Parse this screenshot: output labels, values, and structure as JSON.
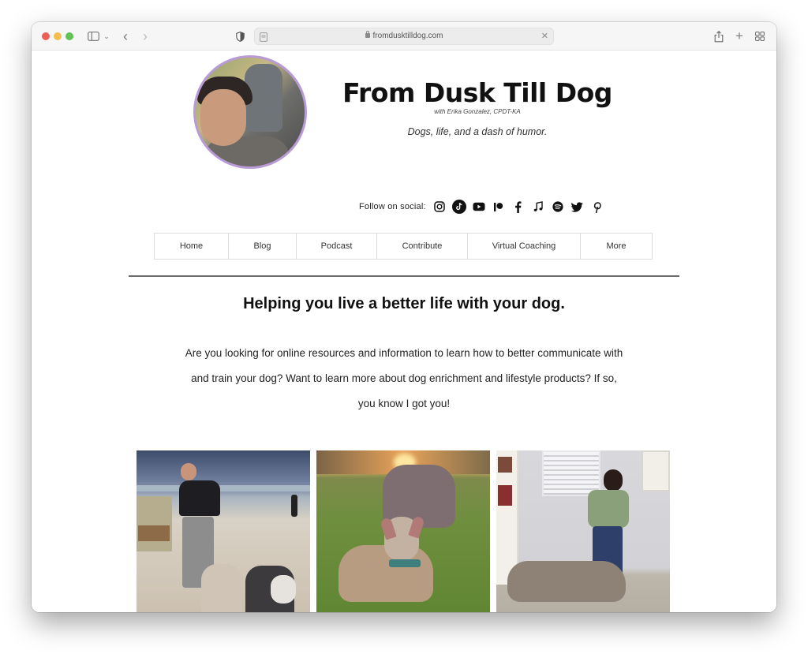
{
  "browser": {
    "url": "fromdusktilldog.com",
    "icons": {
      "sidebar": "sidebar-icon",
      "back": "chevron-left-icon",
      "forward": "chevron-right-icon",
      "privacy": "shield-icon",
      "reader": "reader-icon",
      "lock": "lock-icon",
      "clear": "close-icon",
      "share": "share-icon",
      "new_tab": "plus-icon",
      "tab_overview": "grid-icon"
    },
    "glyphs": {
      "back": "‹",
      "forward": "›",
      "chevron": "⌄",
      "clear": "✕",
      "new_tab": "+"
    }
  },
  "header": {
    "title": "From Dusk Till Dog",
    "byline": "with Erika Gonzalez, CPDT-KA",
    "tagline": "Dogs, life, and a dash of humor.",
    "avatar_ring_color": "#b79ad6"
  },
  "social": {
    "label": "Follow on social:",
    "networks": [
      "instagram",
      "tiktok",
      "youtube",
      "patreon",
      "facebook",
      "apple-music",
      "spotify",
      "twitter",
      "pinterest"
    ]
  },
  "nav": {
    "items": [
      {
        "label": "Home"
      },
      {
        "label": "Blog"
      },
      {
        "label": "Podcast"
      },
      {
        "label": "Contribute"
      },
      {
        "label": "Virtual Coaching"
      },
      {
        "label": "More"
      }
    ]
  },
  "main": {
    "heading": "Helping you live a better life with your dog.",
    "intro": "Are you looking for online resources and information to learn how to better communicate with and train your dog? Want to learn more about dog enrichment and lifestyle products?  If so, you know I got you!",
    "photos": [
      {
        "subject": "woman walking two huskies on beach"
      },
      {
        "subject": "two dogs lying in grass at sunset"
      },
      {
        "subject": "woman training grey dog indoors"
      }
    ]
  }
}
